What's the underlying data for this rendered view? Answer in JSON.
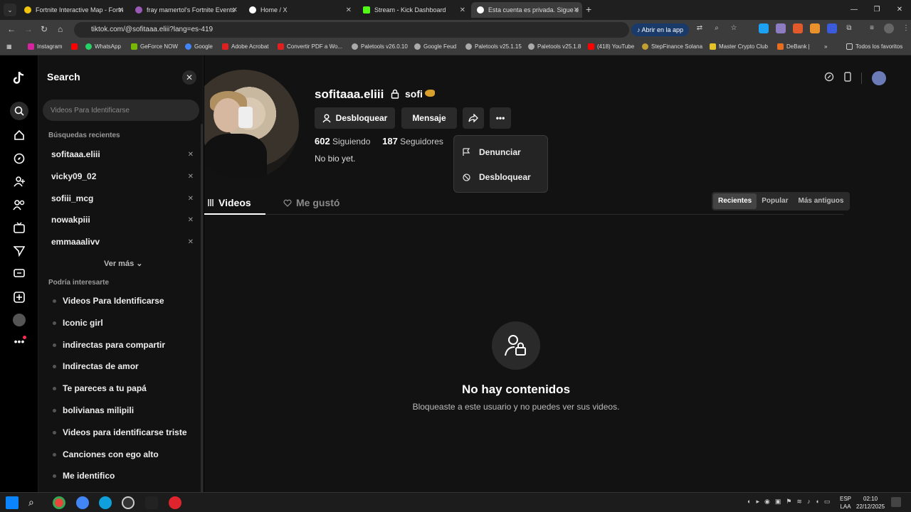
{
  "browser": {
    "tabs": [
      {
        "title": "Fortnite Interactive Map - Fortn",
        "color": "#f1c40f"
      },
      {
        "title": "fray mamertol's Fortnite Events",
        "color": "#9b59b6"
      },
      {
        "title": "Home / X",
        "color": "#ffffff"
      },
      {
        "title": "Stream - Kick Dashboard",
        "color": "#53fc18"
      },
      {
        "title": "Esta cuenta es privada. Sigue e",
        "color": "#ffffff"
      }
    ],
    "url": "tiktok.com/@sofitaaa.eliii?lang=es-419",
    "open_app": "Abrir en la app",
    "bookmarks": [
      "Instagram",
      "WhatsApp",
      "GeForce NOW",
      "Google",
      "Adobe Acrobat",
      "Convertir PDF a Wo...",
      "Paletools v26.0.10",
      "Google Feud",
      "Paletools v25.1.15",
      "Paletools v25.1.8",
      "(418) YouTube",
      "StepFinance Solana",
      "Master Crypto Club",
      "DeBank |",
      "Todos los favoritos"
    ]
  },
  "search_panel": {
    "title": "Search",
    "placeholder": "Videos Para Identificarse",
    "recent_title": "Búsquedas recientes",
    "recent": [
      "sofitaaa.eliii",
      "vicky09_02",
      "sofiii_mcg",
      "nowakpiii",
      "emmaaalivv"
    ],
    "see_more": "Ver más",
    "suggest_title": "Podría interesarte",
    "suggestions": [
      "Videos Para Identificarse",
      "Iconic girl",
      "indirectas para compartir",
      "Indirectas de amor",
      "Te pareces a tu papá",
      "bolivianas milipili",
      "Videos para identificarse triste",
      "Canciones con ego alto",
      "Me identifico"
    ]
  },
  "profile": {
    "username": "sofitaaa.eliii",
    "nickname": "sofi",
    "unblock": "Desbloquear",
    "message": "Mensaje",
    "following_count": "602",
    "following_label": "Siguiendo",
    "followers_count": "187",
    "followers_label": "Seguidores",
    "bio": "No bio yet.",
    "menu": {
      "report": "Denunciar",
      "unblock": "Desbloquear"
    },
    "tabs": {
      "videos": "Videos",
      "liked": "Me gustó"
    },
    "sort": [
      "Recientes",
      "Popular",
      "Más antiguos"
    ],
    "empty_title": "No hay contenidos",
    "empty_sub": "Bloqueaste a este usuario y no puedes ver sus videos."
  },
  "taskbar": {
    "lang": "ESP",
    "lang2": "LAA",
    "time": "02:10",
    "date": "22/12/2025"
  }
}
